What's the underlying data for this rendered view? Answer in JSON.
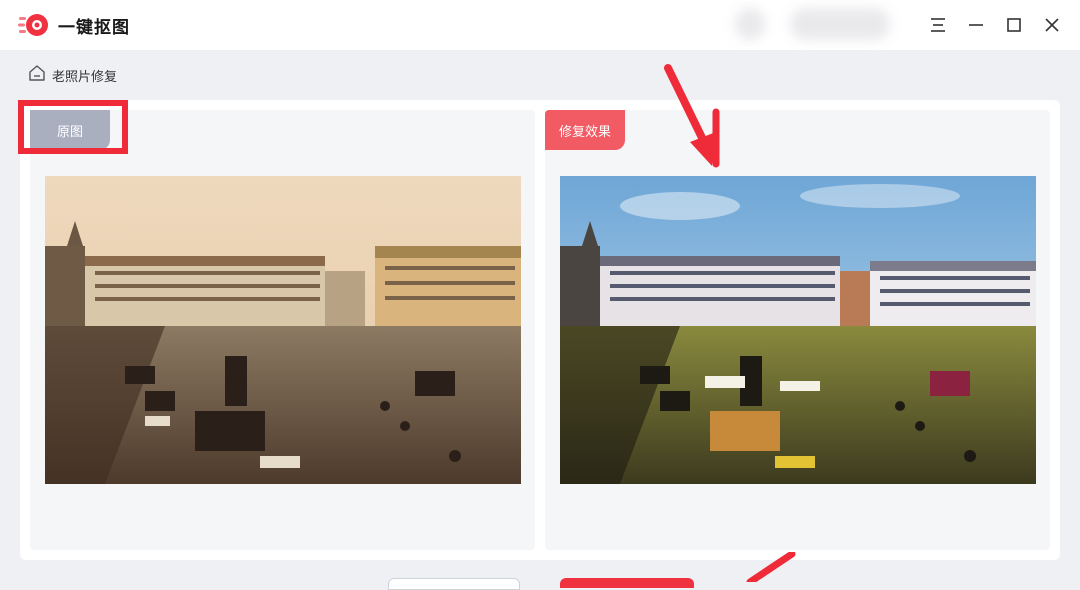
{
  "app": {
    "title": "一键抠图",
    "brand_color": "#f0313f"
  },
  "window_controls": {
    "menu_icon": "menu-icon",
    "minimize_icon": "minimize-icon",
    "maximize_icon": "maximize-icon",
    "close_icon": "close-icon"
  },
  "breadcrumb": {
    "icon": "home-icon",
    "label": "老照片修复"
  },
  "compare": {
    "original": {
      "tag_label": "原图",
      "tag_color": "#a9afbf",
      "image": "original-sepia-photo"
    },
    "restored": {
      "tag_label": "修复效果",
      "tag_color": "#f25a64",
      "image": "restored-color-photo"
    }
  },
  "annotation": {
    "color": "#ef2b3a"
  }
}
